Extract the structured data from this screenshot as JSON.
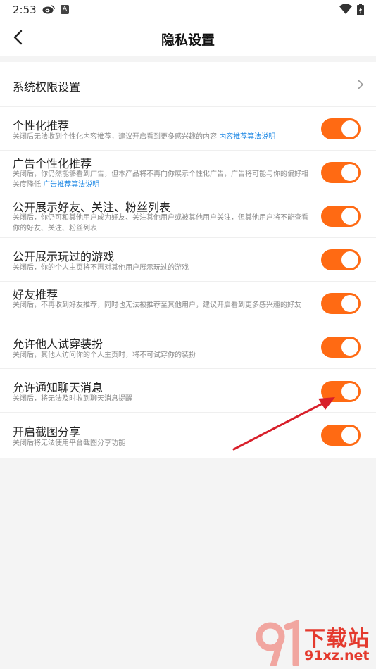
{
  "status_bar": {
    "time": "2:53",
    "a_icon_text": "A"
  },
  "header": {
    "title": "隐私设置"
  },
  "rows": [
    {
      "title": "系统权限设置",
      "type": "link"
    },
    {
      "title": "个性化推荐",
      "desc": "关闭后无法收到个性化内容推荐，建议开启看到更多感兴趣的内容",
      "link": "内容推荐算法说明",
      "enabled": true
    },
    {
      "title": "广告个性化推荐",
      "desc": "关闭后，你仍然能够看到广告，但本产品将不再向你展示个性化广告，广告将可能与你的偏好相关度降低",
      "link": "广告推荐算法说明",
      "enabled": true
    },
    {
      "title": "公开展示好友、关注、粉丝列表",
      "desc": "关闭后，你仍可和其他用户成为好友、关注其他用户或被其他用户关注，但其他用户将不能查看你的好友、关注、粉丝列表",
      "enabled": true
    },
    {
      "title": "公开展示玩过的游戏",
      "desc": "关闭后，你的个人主页将不再对其他用户展示玩过的游戏",
      "enabled": true
    },
    {
      "title": "好友推荐",
      "desc": "关闭后，不再收到好友推荐，同时也无法被推荐至其他用户，建议开启看到更多感兴趣的好友",
      "enabled": true
    },
    {
      "title": "允许他人试穿装扮",
      "desc": "关闭后，其他人访问你的个人主页时，将不可试穿你的装扮",
      "enabled": true
    },
    {
      "title": "允许通知聊天消息",
      "desc": "关闭后，将无法及时收到聊天消息提醒",
      "enabled": true
    },
    {
      "title": "开启截图分享",
      "desc": "关闭后将无法使用平台截图分享功能",
      "enabled": true
    }
  ],
  "watermark": {
    "title": "下载站",
    "url": "91xz.net"
  },
  "colors": {
    "accent": "#ff6a13",
    "link": "#1e88e5",
    "arrow": "#d81f2a"
  }
}
